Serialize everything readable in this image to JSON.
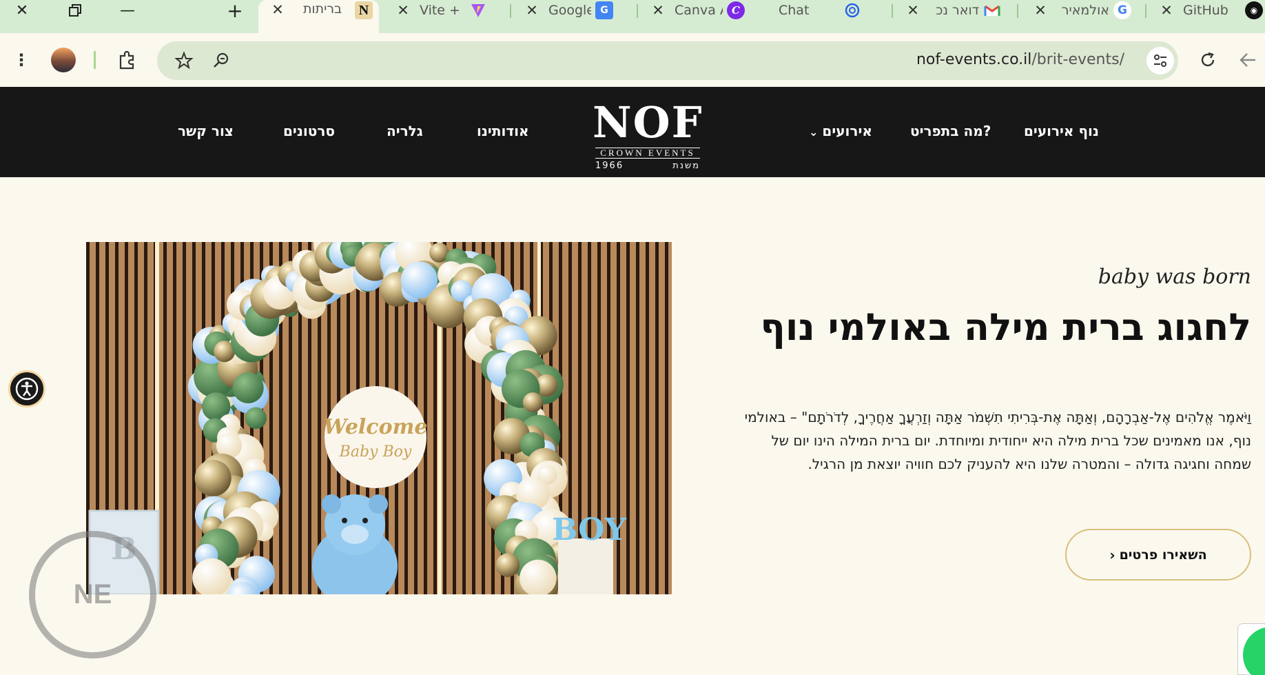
{
  "browser": {
    "tabs": [
      {
        "title": "בריתות",
        "icon": "notion-icon",
        "active": true
      },
      {
        "title": "Vite + R",
        "icon": "vite-icon"
      },
      {
        "title": "Google",
        "icon": "google-translate-icon"
      },
      {
        "title": "Canva A",
        "icon": "canva-icon"
      },
      {
        "title": "Chat",
        "icon": "chatgpt-icon"
      },
      {
        "title": "דואר נכ",
        "icon": "gmail-icon"
      },
      {
        "title": "אולמאיר",
        "icon": "google-icon"
      },
      {
        "title": "GitHub",
        "icon": "github-icon"
      }
    ],
    "url_domain": "nof-events.co.il",
    "url_path": "/brit-events/"
  },
  "site": {
    "logo": {
      "main": "NOF",
      "sub": "CROWN EVENTS",
      "year": "1966",
      "since": "משנת"
    },
    "nav": {
      "home": "נוף אירועים",
      "menu": "מה בתפריט?",
      "events": "אירועים",
      "about": "אודותינו",
      "gallery": "גלריה",
      "videos": "סרטונים",
      "contact": "צור קשר"
    }
  },
  "hero": {
    "script_text": "baby was born",
    "title": "לחגוג ברית מילה באולמי נוף",
    "paragraph": "וַיֹּאמֶר אֱלֹהִים אֶל-אַבְרָהָם, וְאַתָּה אֶת-בְּרִיתִי תִשְׁמֹר אַתָּה וְזַרְעֲךָ אַחֲרֶיךָ, לְדֹרֹתָם\" – באולמי נוף, אנו מאמינים שכל ברית מילה היא ייחודית ומיוחדת. יום ברית המילה הינו יום של שמחה וחגיגה גדולה – והמטרה שלנו היא להעניק לכם חוויה יוצאת מן הרגיל.",
    "cta_label": "השאירו פרטים",
    "photo": {
      "sign_line1": "Welcome",
      "sign_line2": "Baby Boy",
      "boy_letters": "BOY",
      "block_letter": "B"
    }
  },
  "colors": {
    "header_bg": "#171717",
    "page_bg": "#fbf8ee",
    "cta_border": "#d8bf7b",
    "tab_strip": "#d6ecd2"
  }
}
